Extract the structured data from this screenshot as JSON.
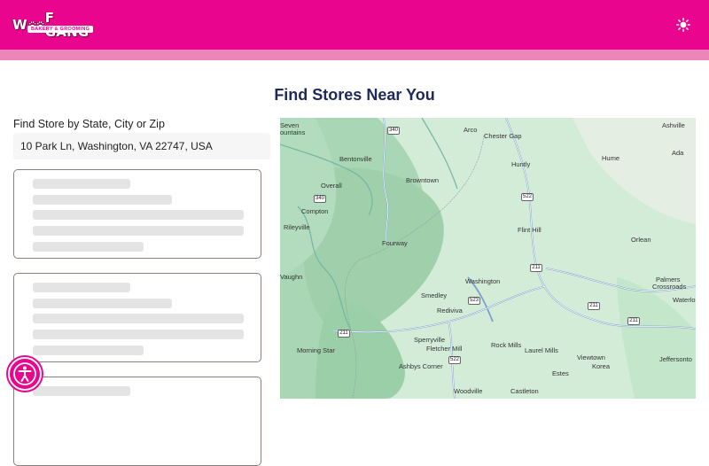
{
  "header": {
    "logo_text_left": "W",
    "logo_text_right": "F GANG",
    "logo_subtitle": "BAKERY & GROOMING",
    "theme_toggle_icon": "sun-icon",
    "brand_color": "#e9058d",
    "strip_color": "#ee85b8"
  },
  "main": {
    "title": "Find Stores Near You",
    "search": {
      "label": "Find Store by State, City or Zip",
      "value": "10 Park Ln, Washington, VA 22747, USA"
    }
  },
  "map": {
    "places": [
      "Seven",
      "ountains",
      "Arco",
      "Chester Gap",
      "Ashville",
      "Ada",
      "Hume",
      "Huntly",
      "Bentonville",
      "Overall",
      "Browntown",
      "Compton",
      "Rileyville",
      "Fourway",
      "Flint Hill",
      "Orlean",
      "Vaughn",
      "Washington",
      "Palmers",
      "Crossroads",
      "Waterlo",
      "Smedley",
      "Rediviva",
      "Sperryville",
      "Fletcher Mill",
      "Rock Mills",
      "Laurel Mills",
      "Morning Star",
      "Viewtown",
      "Jeffersonto",
      "Korea",
      "Ashbys Corner",
      "Estes",
      "Woodville",
      "Castleton"
    ],
    "route_shields": [
      "340",
      "340",
      "522",
      "211",
      "523",
      "211",
      "211",
      "211",
      "522"
    ]
  },
  "accessibility_button": {
    "icon": "accessibility-icon"
  }
}
